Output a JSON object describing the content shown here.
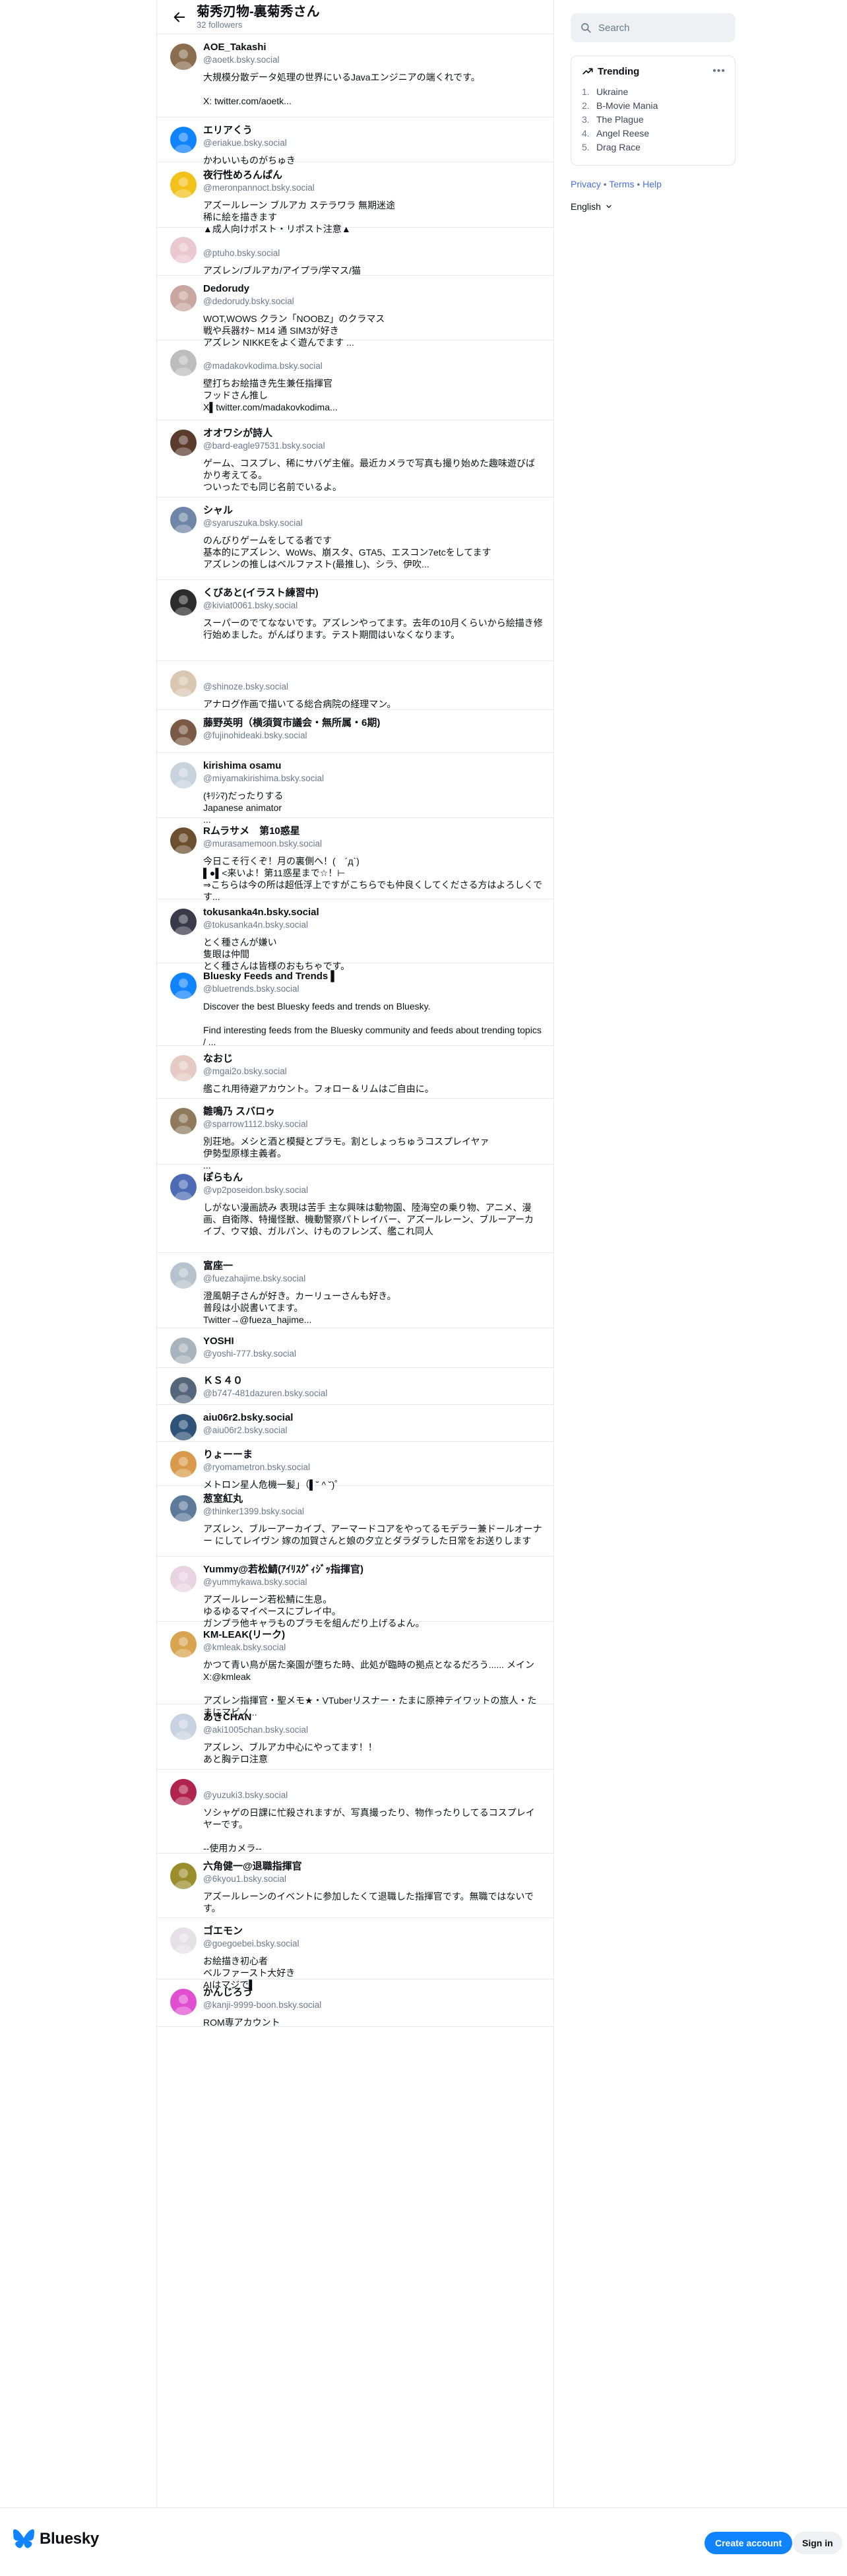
{
  "header": {
    "title": "菊秀刃物-裏菊秀さん",
    "subtitle": "32 followers",
    "back_icon": "arrow-left-icon"
  },
  "search": {
    "placeholder": "Search",
    "icon": "search-icon"
  },
  "trending": {
    "title": "Trending",
    "icon": "trending-up-icon",
    "more_icon": "more-horizontal-icon",
    "items": [
      {
        "num": "1.",
        "label": "Ukraine"
      },
      {
        "num": "2.",
        "label": "B-Movie Mania"
      },
      {
        "num": "3.",
        "label": "The Plague"
      },
      {
        "num": "4.",
        "label": "Angel Reese"
      },
      {
        "num": "5.",
        "label": "Drag Race"
      }
    ]
  },
  "footer_links": {
    "privacy": "Privacy",
    "sep": "•",
    "terms": "Terms",
    "help": "Help"
  },
  "language": {
    "label": "English",
    "icon": "chevron-down-icon"
  },
  "bottom_bar": {
    "brand": "Bluesky",
    "brand_icon": "butterfly-logo-icon",
    "create_account": "Create account",
    "sign_in": "Sign in"
  },
  "followers": [
    {
      "name": "AOE_Takashi",
      "handle": "@aoetk.bsky.social",
      "bio": "大規模分散データ処理の世界にいるJavaエンジニアの端くれです。\n\nX: twitter.com/aoetk..."
    },
    {
      "name": "エリアくう",
      "handle": "@eriakue.bsky.social",
      "bio": "かわいいものがちゅき"
    },
    {
      "name": "夜行性めろんぱん",
      "handle": "@meronpannoct.bsky.social",
      "bio": "アズールレーン ブルアカ ステラワラ 無期迷途\n稀に絵を描きます\n▲成人向けポスト・リポスト注意▲"
    },
    {
      "name": "",
      "handle": "@ptuho.bsky.social",
      "bio": "アズレン/ブルアカ/アイプラ/学マス/猫"
    },
    {
      "name": "Dedorudy",
      "handle": "@dedorudy.bsky.social",
      "bio": "WOT,WOWS クラン「NOOBZ」のクラマス\n戦や兵器ｵﾀ~ M14 通 SIM3が好き\nアズレン NIKKEをよく遊んでます ..."
    },
    {
      "name": "",
      "handle": "@madakovkodima.bsky.social",
      "bio": "壁打ちお絵描き先生兼任指揮官\nフッドさん推し\nX▌twitter.com/madakovkodima..."
    },
    {
      "name": "オオワシが詩人",
      "handle": "@bard-eagle97531.bsky.social",
      "bio": "ゲーム、コスプレ、稀にサバゲ主催。最近カメラで写真も撮り始めた趣味遊びばかり考えてる。\nついったでも同じ名前でいるよ。"
    },
    {
      "name": "シャル",
      "handle": "@syaruszuka.bsky.social",
      "bio": "のんびりゲームをしてる者です\n基本的にアズレン、WoWs、崩スタ、GTA5、エスコン7etcをしてます\nアズレンの推しはベルファスト(最推し)、シラ、伊吹..."
    },
    {
      "name": "くびあと(イラスト練習中)",
      "handle": "@kiviat0061.bsky.social",
      "bio": "スーパーのでてなないです。アズレンやってます。去年の10月くらいから絵描き修行始めました。がんばります。テスト期間はいなくなります。"
    },
    {
      "name": "",
      "handle": "@shinoze.bsky.social",
      "bio": "アナログ作画で描いてる総合病院の経理マン。"
    },
    {
      "name": "藤野英明（横須賀市議会・無所属・6期)",
      "handle": "@fujinohideaki.bsky.social",
      "bio": ""
    },
    {
      "name": "kirishima osamu",
      "handle": "@miyamakirishima.bsky.social",
      "bio": "(ｷﾘｼﾏ)だったりする\nJapanese animator\n..."
    },
    {
      "name": "Rムラサメ　第10惑星",
      "handle": "@murasamemoon.bsky.social",
      "bio": "今日こそ行くぞ！月の裏側へ！(　´д`)\n▌●▌<来いよ！第11惑星まで☆！⊢\n⇒こちらは今の所は超低浮上ですがこちらでも仲良くしてくださる方はよろしくです..."
    },
    {
      "name": "tokusanka4n.bsky.social",
      "handle": "@tokusanka4n.bsky.social",
      "bio": "とく種さんが嫌い\n隻眼は仲間\nとく種さんは皆様のおもちゃです。"
    },
    {
      "name": "Bluesky Feeds and Trends ▌",
      "handle": "@bluetrends.bsky.social",
      "bio": "Discover the best Bluesky feeds and trends on Bluesky.\n\nFind interesting feeds from the Bluesky community and feeds about trending topics / ..."
    },
    {
      "name": "なおじ",
      "handle": "@mgai2o.bsky.social",
      "bio": "艦これ用待避アカウント。フォロー＆リムはご自由に。"
    },
    {
      "name": "雛鳴乃 スバロゥ",
      "handle": "@sparrow1112.bsky.social",
      "bio": "別荘地。メシと酒と模擬とプラモ。割としょっちゅうコスプレイヤァ\n伊勢型原様主義者。\n..."
    },
    {
      "name": "ぽらもん",
      "handle": "@vp2poseidon.bsky.social",
      "bio": "しがない漫画読み 表現は苦手 主な興味は動物園、陸海空の乗り物、アニメ、漫画、自衛隊、特撮怪獣、機動警察パトレイバー、アズールレーン、ブルーアーカイブ、ウマ娘、ガルパン、けものフレンズ、艦これ同人"
    },
    {
      "name": "富座一",
      "handle": "@fuezahajime.bsky.social",
      "bio": "澄風朝子さんが好き。カーリューさんも好き。\n普段は小説書いてます。\nTwitter→@fueza_hajime..."
    },
    {
      "name": "YOSHI",
      "handle": "@yoshi-777.bsky.social",
      "bio": ""
    },
    {
      "name": "ＫＳ４０",
      "handle": "@b747-481dazuren.bsky.social",
      "bio": ""
    },
    {
      "name": "aiu06r2.bsky.social",
      "handle": "@aiu06r2.bsky.social",
      "bio": ""
    },
    {
      "name": "りょーーま",
      "handle": "@ryomametron.bsky.social",
      "bio": "メトロン星人危機一髪」（▌˘ ^ ˘)゜"
    },
    {
      "name": "葱室紅丸",
      "handle": "@thinker1399.bsky.social",
      "bio": "アズレン、ブルーアーカイブ、アーマードコアをやってるモデラー兼ドールオーナー にしてレイヴン 嫁の加賀さんと娘の夕立とダラダラした日常をお送りします"
    },
    {
      "name": "Yummy@若松鯖(ｱｲﾘｽｸﾞｨｼﾞｯ指揮官)",
      "handle": "@yummykawa.bsky.social",
      "bio": "アズールレーン若松鯖に生息。\nゆるゆるマイペースにプレイ中。\nガンプラ他キャラものプラモを組んだり上げるよん。"
    },
    {
      "name": "KM-LEAK(リーク)",
      "handle": "@kmleak.bsky.social",
      "bio": "かつて青い鳥が居た楽園が堕ちた時、此処が臨時の拠点となるだろう...... メインX:@kmleak\n\nアズレン指揮官・聖メモ★・VTuberリスナー・たまに原神テイワットの旅人・たまにマビノ..."
    },
    {
      "name": "あきCHAN",
      "handle": "@aki1005chan.bsky.social",
      "bio": "アズレン、ブルアカ中心にやってます！！\nあと胸テロ注意"
    },
    {
      "name": "",
      "handle": "@yuzuki3.bsky.social",
      "bio": "ソシャゲの日課に忙殺されますが、写真撮ったり、物作ったりしてるコスプレイヤーです。\n\n--使用カメラ--"
    },
    {
      "name": "六角健一@退職指揮官",
      "handle": "@6kyou1.bsky.social",
      "bio": "アズールレーンのイベントに参加したくて退職した指揮官です。無職ではないです。"
    },
    {
      "name": "ゴエモン",
      "handle": "@goegoebei.bsky.social",
      "bio": "お絵描き初心者\nベルファースト大好き\nAIはマジで▌"
    },
    {
      "name": "かんじろう",
      "handle": "@kanji-9999-boon.bsky.social",
      "bio": "ROM専アカウント"
    }
  ]
}
